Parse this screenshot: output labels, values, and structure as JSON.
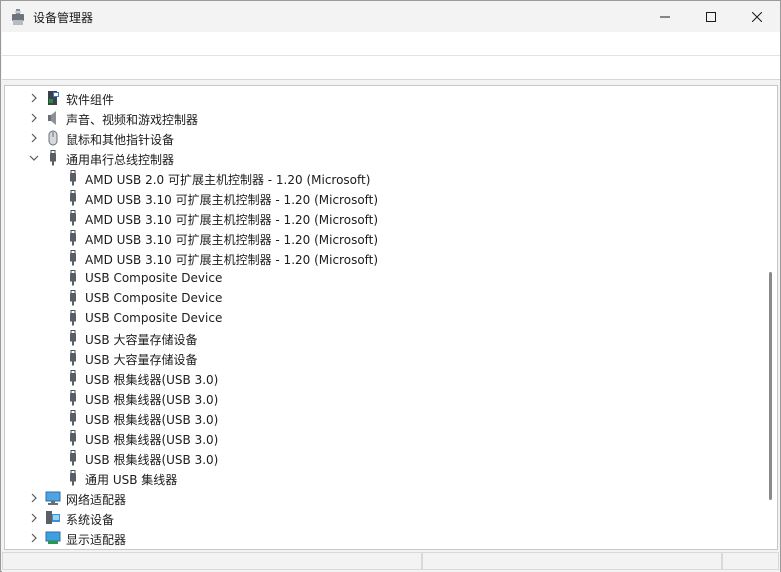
{
  "window": {
    "title": "设备管理器"
  },
  "tree": [
    {
      "label": "软件组件",
      "icon": "software-component-icon",
      "expanded": false
    },
    {
      "label": "声音、视频和游戏控制器",
      "icon": "speaker-icon",
      "expanded": false
    },
    {
      "label": "鼠标和其他指针设备",
      "icon": "mouse-icon",
      "expanded": false
    },
    {
      "label": "通用串行总线控制器",
      "icon": "usb-icon",
      "expanded": true,
      "children": [
        "AMD USB 2.0 可扩展主机控制器 - 1.20 (Microsoft)",
        "AMD USB 3.10 可扩展主机控制器 - 1.20 (Microsoft)",
        "AMD USB 3.10 可扩展主机控制器 - 1.20 (Microsoft)",
        "AMD USB 3.10 可扩展主机控制器 - 1.20 (Microsoft)",
        "AMD USB 3.10 可扩展主机控制器 - 1.20 (Microsoft)",
        "USB Composite Device",
        "USB Composite Device",
        "USB Composite Device",
        "USB 大容量存储设备",
        "USB 大容量存储设备",
        "USB 根集线器(USB 3.0)",
        "USB 根集线器(USB 3.0)",
        "USB 根集线器(USB 3.0)",
        "USB 根集线器(USB 3.0)",
        "USB 根集线器(USB 3.0)",
        "通用 USB 集线器"
      ]
    },
    {
      "label": "网络适配器",
      "icon": "network-adapter-icon",
      "expanded": false
    },
    {
      "label": "系统设备",
      "icon": "system-device-icon",
      "expanded": false
    },
    {
      "label": "显示适配器",
      "icon": "display-adapter-icon",
      "expanded": false
    }
  ],
  "icons": {
    "app": "device-manager-icon",
    "minimize": "minimize-icon",
    "maximize": "maximize-icon",
    "close": "close-icon",
    "chevron_right": "chevron-right-icon",
    "chevron_down": "chevron-down-icon"
  },
  "colors": {
    "window_bg": "#f3f3f3",
    "tree_bg": "#ffffff",
    "scroll_thumb": "#8a8a8a"
  }
}
